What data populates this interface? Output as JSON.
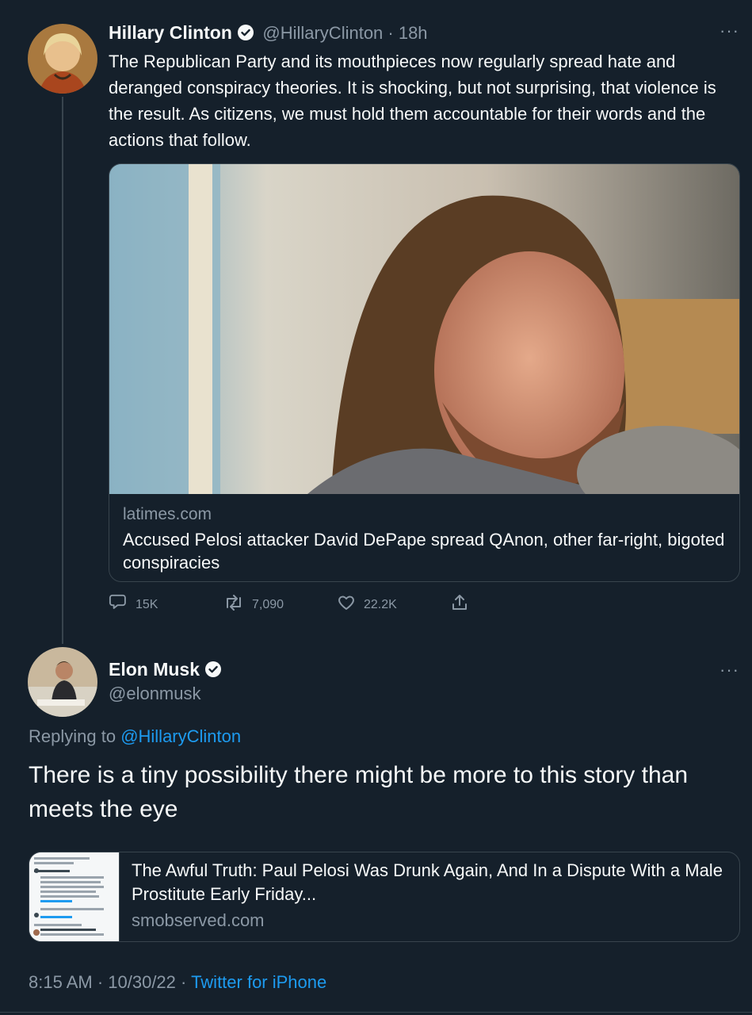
{
  "tweet1": {
    "name": "Hillary Clinton",
    "handle_time": "@HillaryClinton · 18h",
    "text": "The Republican Party and its mouthpieces now regularly spread hate and deranged conspiracy theories. It is shocking, but not surprising, that violence is the result. As citizens, we must hold them accountable for their words and the actions that follow.",
    "card": {
      "domain": "latimes.com",
      "title": "Accused Pelosi attacker David DePape spread QAnon, other far-right, bigoted conspiracies"
    },
    "actions": {
      "replies": "15K",
      "retweets": "7,090",
      "likes": "22.2K"
    }
  },
  "tweet2": {
    "name": "Elon Musk",
    "handle": "@elonmusk",
    "replying_prefix": "Replying to ",
    "replying_to": "@HillaryClinton",
    "text": "There is a tiny possibility there might be more to this story than meets the eye",
    "card": {
      "title": "The Awful Truth: Paul Pelosi Was Drunk Again, And In a Dispute With a Male Prostitute Early Friday...",
      "domain": "smobserved.com"
    },
    "meta": {
      "time_date": "8:15 AM · 10/30/22 · ",
      "source": "Twitter for iPhone"
    }
  },
  "colors": {
    "background": "#15202b",
    "accent": "#1d9bf0",
    "muted": "#8b98a5",
    "border": "#38444d"
  },
  "icons": [
    "verified-badge-icon",
    "more-options-icon",
    "reply-icon",
    "retweet-icon",
    "like-icon",
    "share-icon"
  ]
}
